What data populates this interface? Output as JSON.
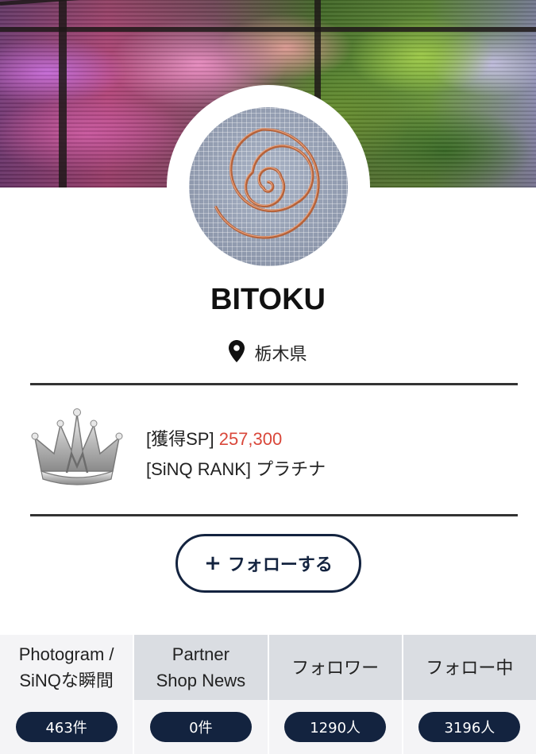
{
  "profile": {
    "name": "BITOKU",
    "location": "栃木県"
  },
  "stats": {
    "sp_label": "[獲得SP]",
    "sp_value": "257,300",
    "rank_label": "[SiNQ RANK]",
    "rank_value": "プラチナ"
  },
  "actions": {
    "follow_plus": "+",
    "follow_label": "フォローする"
  },
  "tabs": [
    {
      "label_line1": "Photogram /",
      "label_line2": "SiNQな瞬間",
      "count": "463件"
    },
    {
      "label_line1": "Partner",
      "label_line2": "Shop News",
      "count": "0件"
    },
    {
      "label_line1": "フォロワー",
      "label_line2": "",
      "count": "1290人"
    },
    {
      "label_line1": "フォロー中",
      "label_line2": "",
      "count": "3196人"
    }
  ],
  "colors": {
    "navy": "#13233f",
    "sp_highlight": "#d9473a",
    "tab_bg": "#dadde2",
    "tab_active_bg": "#f4f4f6"
  },
  "icons": {
    "location": "map-pin-icon",
    "rank": "crown-icon"
  }
}
